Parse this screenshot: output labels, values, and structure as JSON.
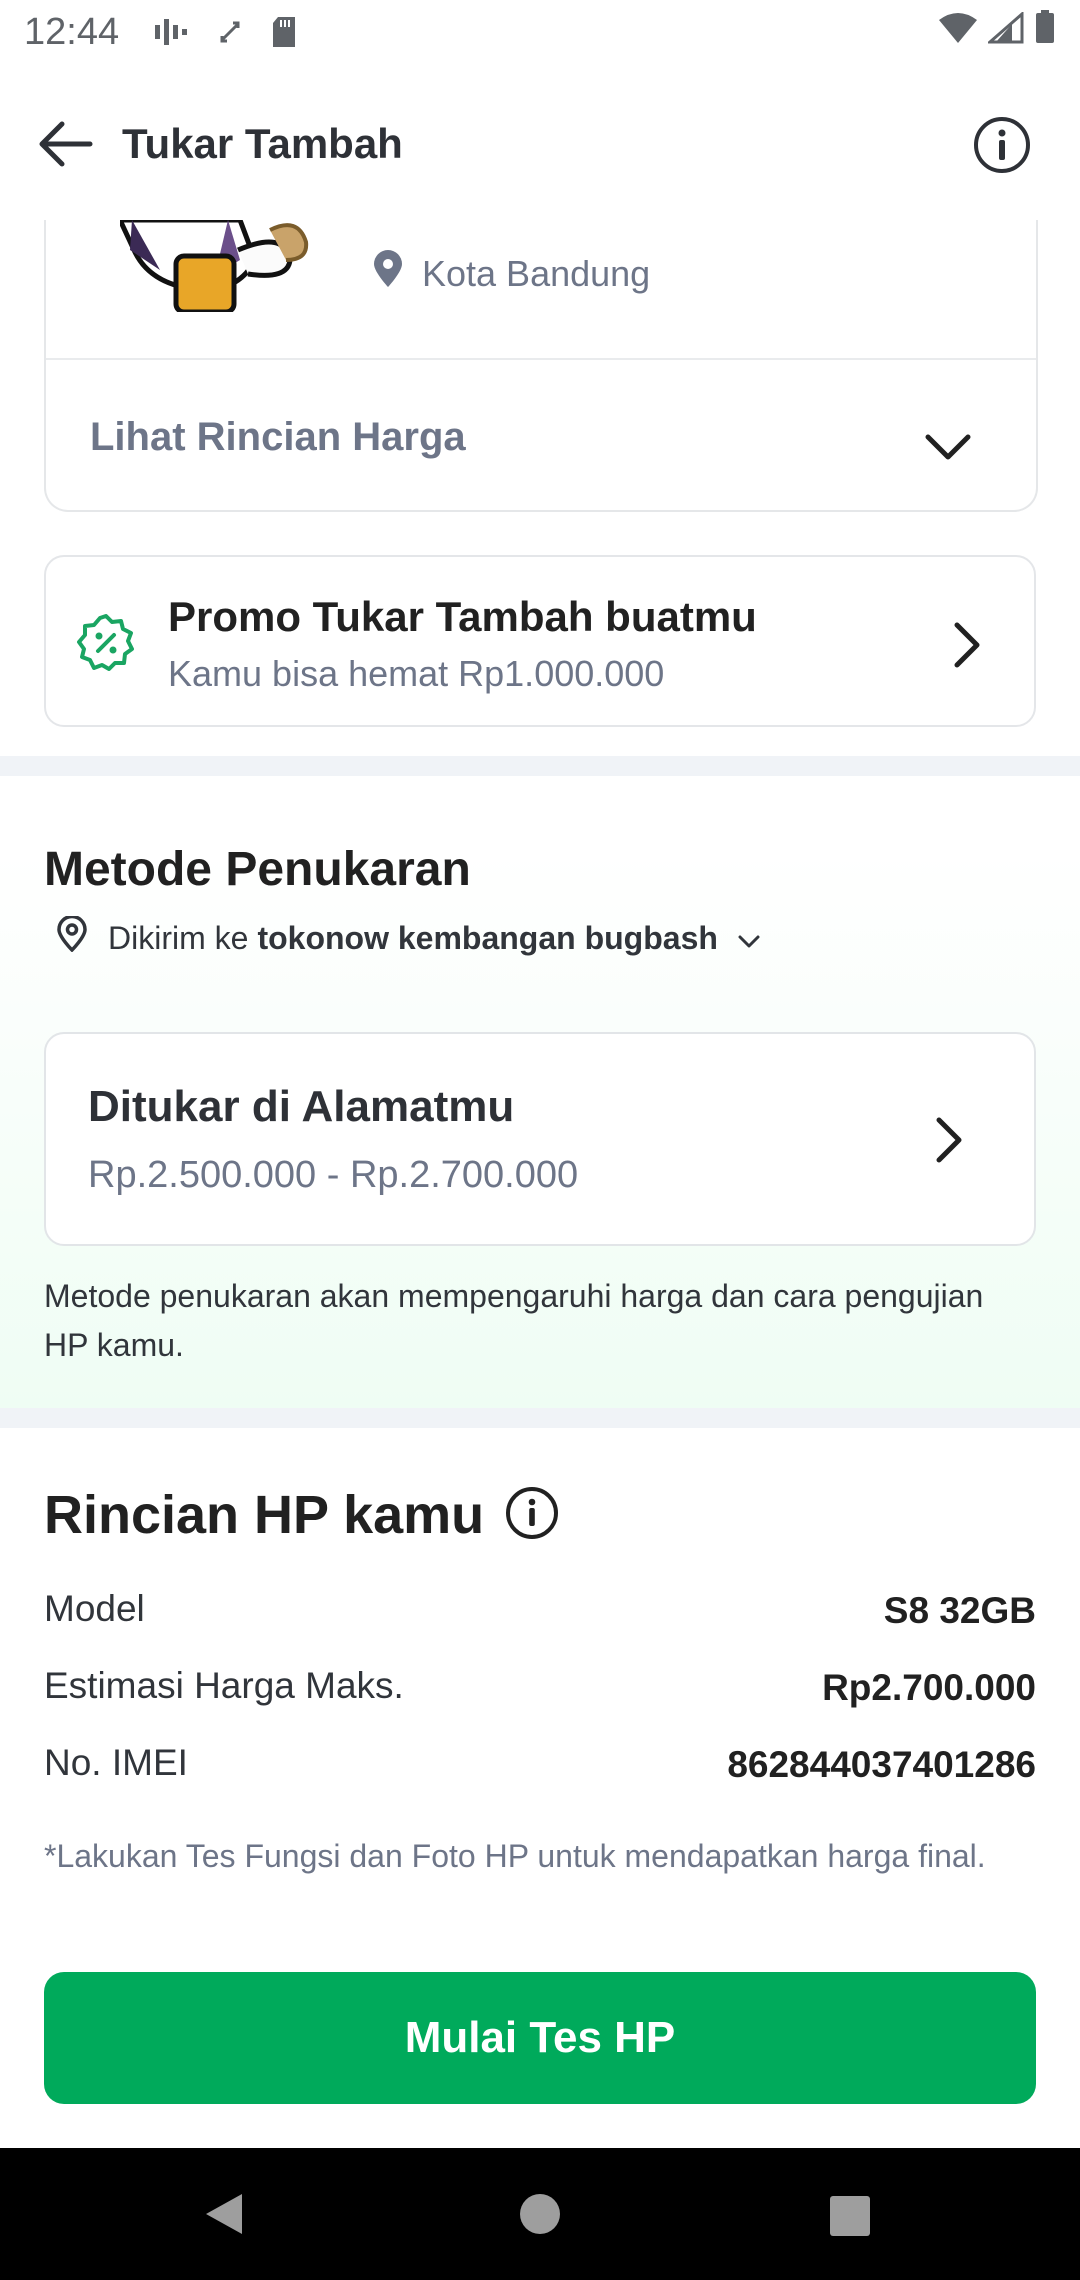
{
  "status_bar": {
    "time": "12:44"
  },
  "app_bar": {
    "title": "Tukar Tambah"
  },
  "device_card": {
    "location": "Kota Bandung",
    "price_detail_label": "Lihat Rincian Harga"
  },
  "promo": {
    "title": "Promo Tukar Tambah buatmu",
    "subtitle": "Kamu bisa hemat Rp1.000.000"
  },
  "exchange_method": {
    "heading": "Metode Penukaran",
    "address_prefix": "Dikirim ke",
    "address_name": "tokonow kembangan bugbash",
    "option": {
      "title": "Ditukar di Alamatmu",
      "price_range": "Rp.2.500.000 - Rp.2.700.000"
    },
    "note": "Metode penukaran akan mempengaruhi harga dan cara pengujian HP kamu."
  },
  "phone_details": {
    "heading": "Rincian HP kamu",
    "rows": [
      {
        "label": "Model",
        "value": "S8 32GB"
      },
      {
        "label": "Estimasi Harga Maks.",
        "value": "Rp2.700.000"
      },
      {
        "label": "No. IMEI",
        "value": "862844037401286"
      }
    ],
    "disclaimer": "*Lakukan Tes Fungsi dan Foto HP untuk mendapatkan harga final."
  },
  "cta": {
    "label": "Mulai Tes HP"
  },
  "colors": {
    "primary_green": "#00aa5b",
    "text_dark": "#212121",
    "text_muted": "#6d7588"
  }
}
